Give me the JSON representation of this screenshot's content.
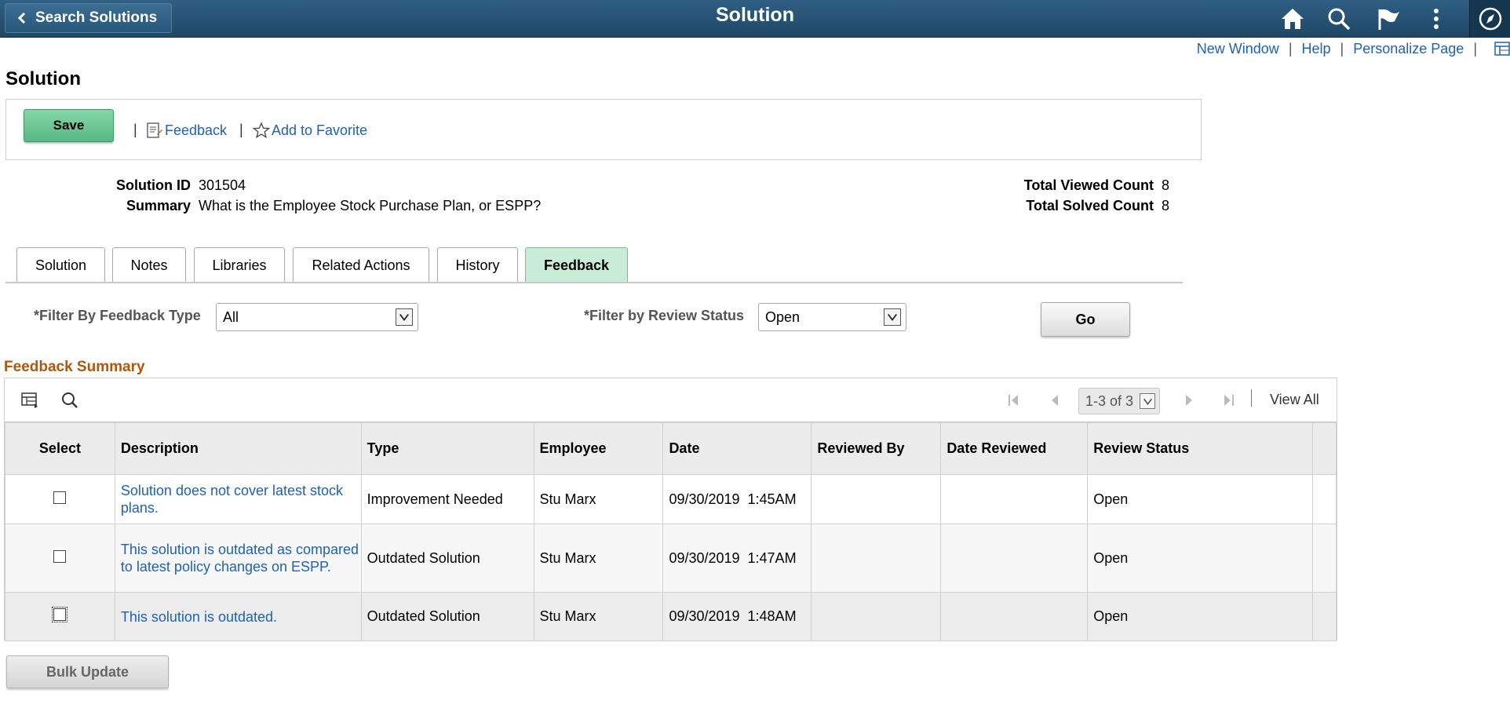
{
  "header": {
    "back_label": "Search Solutions",
    "title": "Solution",
    "icons": [
      "home-icon",
      "search-icon",
      "flag-icon",
      "more-icon",
      "navbar-icon"
    ]
  },
  "util_links": {
    "new_window": "New Window",
    "help": "Help",
    "personalize": "Personalize Page",
    "sep": "|"
  },
  "page_title": "Solution",
  "toolbar": {
    "save_label": "Save",
    "sep": "|",
    "feedback_label": "Feedback",
    "favorite_label": "Add to Favorite"
  },
  "info": {
    "solution_id_label": "Solution ID",
    "solution_id": "301504",
    "summary_label": "Summary",
    "summary": "What is the Employee Stock Purchase Plan, or ESPP?",
    "viewed_label": "Total Viewed Count",
    "viewed": "8",
    "solved_label": "Total Solved Count",
    "solved": "8"
  },
  "tabs": [
    {
      "label": "Solution",
      "active": false
    },
    {
      "label": "Notes",
      "active": false
    },
    {
      "label": "Libraries",
      "active": false
    },
    {
      "label": "Related Actions",
      "active": false
    },
    {
      "label": "History",
      "active": false
    },
    {
      "label": "Feedback",
      "active": true
    }
  ],
  "filters": {
    "type_label": "*Filter By Feedback Type",
    "type_value": "All",
    "status_label": "*Filter by Review Status",
    "status_value": "Open",
    "go_label": "Go"
  },
  "section_title": "Feedback Summary",
  "grid": {
    "range": "1-3 of 3",
    "view_all": "View All",
    "columns": [
      "Select",
      "Description",
      "Type",
      "Employee",
      "Date",
      "Reviewed By",
      "Date Reviewed",
      "Review Status",
      ""
    ],
    "rows": [
      {
        "description": "Solution does not cover latest stock plans.",
        "type": "Improvement Needed",
        "employee": "Stu Marx",
        "date": "09/30/2019  1:45AM",
        "reviewed_by": "",
        "date_reviewed": "",
        "status": "Open"
      },
      {
        "description": "This solution is outdated as compared to latest policy changes on ESPP.",
        "type": "Outdated Solution",
        "employee": "Stu Marx",
        "date": "09/30/2019  1:47AM",
        "reviewed_by": "",
        "date_reviewed": "",
        "status": "Open"
      },
      {
        "description": "This solution is outdated.",
        "type": "Outdated Solution",
        "employee": "Stu Marx",
        "date": "09/30/2019  1:48AM",
        "reviewed_by": "",
        "date_reviewed": "",
        "status": "Open"
      }
    ]
  },
  "bulk_update_label": "Bulk Update",
  "colors": {
    "header_bg": "#2a5577",
    "link": "#2061b5",
    "section_title": "#b0560d",
    "save_btn": "#6cc795",
    "active_tab": "#c9ecd6"
  }
}
